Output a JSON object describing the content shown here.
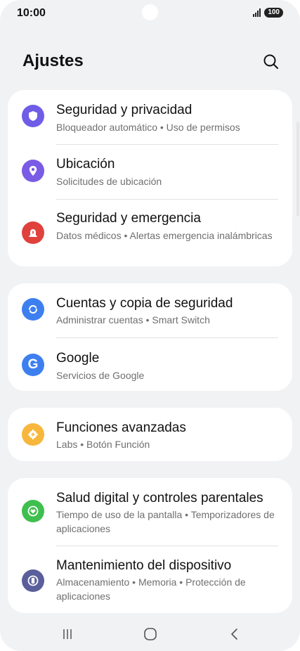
{
  "status_bar": {
    "time": "10:00",
    "battery": "100"
  },
  "header": {
    "title": "Ajustes",
    "search_icon": "search-icon"
  },
  "cards": [
    {
      "items": [
        {
          "title": "Seguridad y privacidad",
          "subtitle": "Bloqueador automático • Uso de permisos",
          "icon": "shield-icon",
          "color": "#6f5de8"
        },
        {
          "title": "Ubicación",
          "subtitle": "Solicitudes de ubicación",
          "icon": "location-pin-icon",
          "color": "#7a5be6"
        },
        {
          "title": "Seguridad y emergencia",
          "subtitle": "Datos médicos • Alertas emergencia inalámbricas",
          "icon": "emergency-siren-icon",
          "color": "#e0413d"
        }
      ]
    },
    {
      "items": [
        {
          "title": "Cuentas y copia de seguridad",
          "subtitle": "Administrar cuentas • Smart Switch",
          "icon": "sync-icon",
          "color": "#3e7ff0"
        },
        {
          "title": "Google",
          "subtitle": "Servicios de Google",
          "icon": "google-icon",
          "color": "#3e7ff0"
        }
      ]
    },
    {
      "items": [
        {
          "title": "Funciones avanzadas",
          "subtitle": "Labs • Botón Función",
          "icon": "gear-plus-icon",
          "color": "#f6b73c"
        }
      ]
    },
    {
      "items": [
        {
          "title": "Salud digital y controles parentales",
          "subtitle": "Tiempo de uso de la pantalla • Temporizadores de aplicaciones",
          "icon": "heart-timer-icon",
          "color": "#3fbf4e"
        },
        {
          "title": "Mantenimiento del dispositivo",
          "subtitle": "Almacenamiento • Memoria • Protección de aplicaciones",
          "icon": "device-care-icon",
          "color": "#5a5e9a"
        }
      ]
    }
  ],
  "nav_bar": {
    "recents_icon": "recents-icon",
    "home_icon": "home-icon",
    "back_icon": "back-icon"
  }
}
